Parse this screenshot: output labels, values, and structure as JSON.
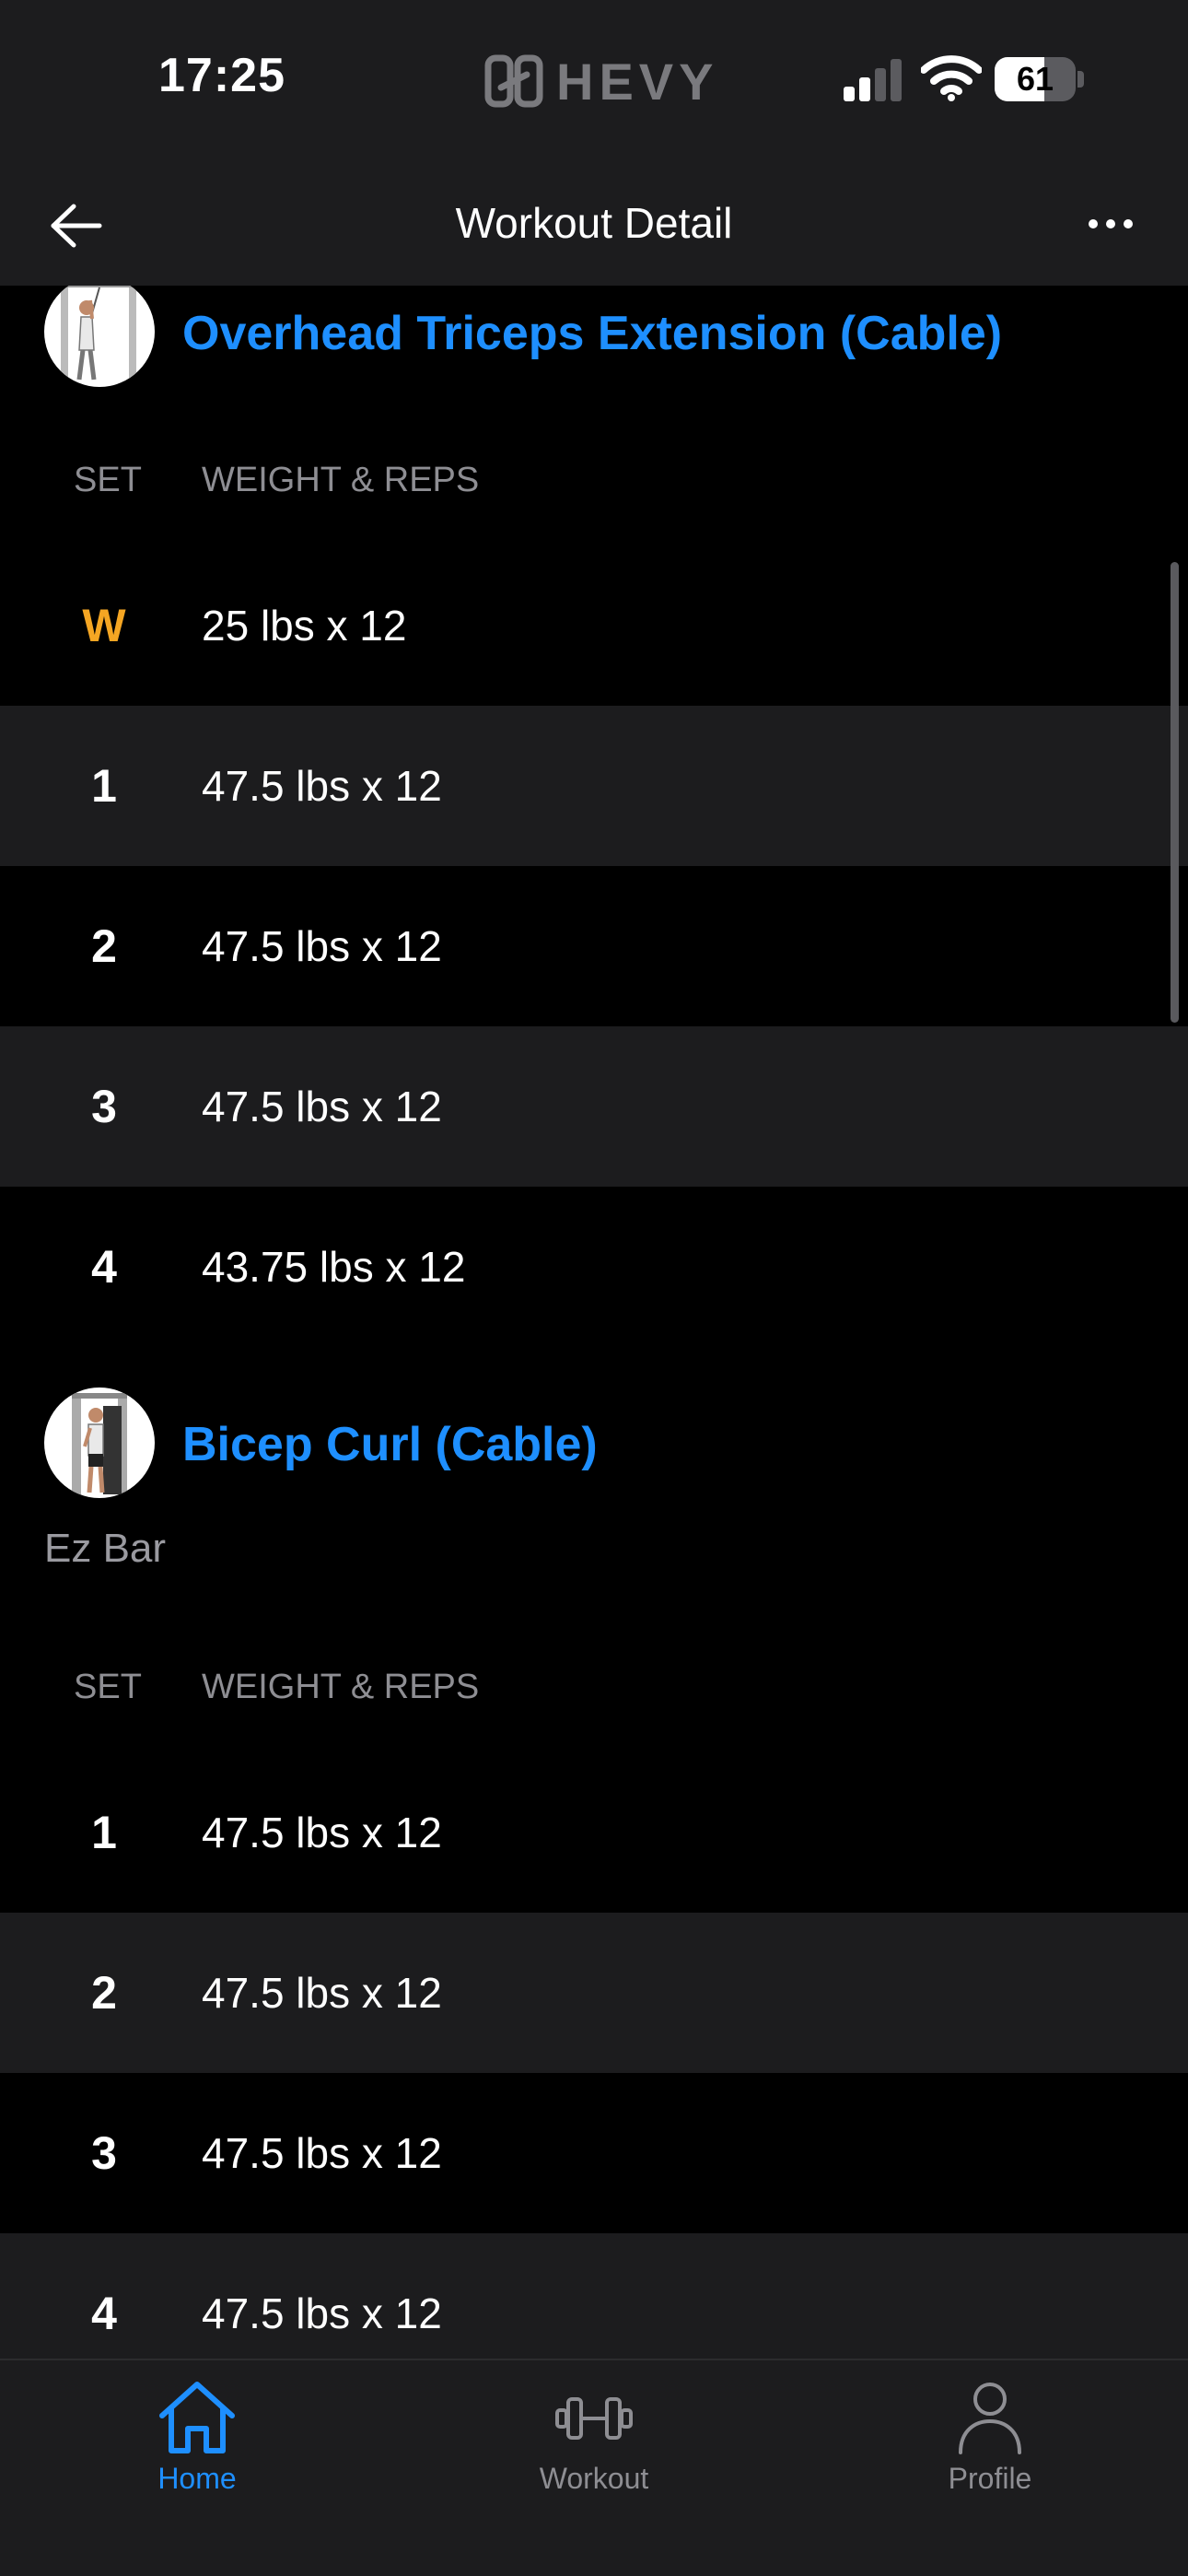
{
  "status_bar": {
    "time": "17:25",
    "brand": "HEVY",
    "battery_percent": 61
  },
  "nav": {
    "title": "Workout Detail",
    "back_icon": "arrow-left-icon",
    "more_icon": "ellipsis-icon"
  },
  "exercises": [
    {
      "title": "Overhead Triceps Extension (Cable)",
      "note": "",
      "columns": {
        "set": "SET",
        "weight_reps": "WEIGHT & REPS"
      },
      "sets": [
        {
          "set": "W",
          "value": "25 lbs x 12",
          "warmup": true
        },
        {
          "set": "1",
          "value": "47.5 lbs x 12"
        },
        {
          "set": "2",
          "value": "47.5 lbs x 12"
        },
        {
          "set": "3",
          "value": "47.5 lbs x 12"
        },
        {
          "set": "4",
          "value": "43.75 lbs x 12"
        }
      ]
    },
    {
      "title": "Bicep Curl (Cable)",
      "note": "Ez Bar",
      "columns": {
        "set": "SET",
        "weight_reps": "WEIGHT & REPS"
      },
      "sets": [
        {
          "set": "1",
          "value": "47.5 lbs x 12"
        },
        {
          "set": "2",
          "value": "47.5 lbs x 12"
        },
        {
          "set": "3",
          "value": "47.5 lbs x 12"
        },
        {
          "set": "4",
          "value": "47.5 lbs x 12"
        }
      ]
    }
  ],
  "tab_bar": {
    "items": [
      {
        "label": "Home",
        "icon": "home-icon",
        "active": true
      },
      {
        "label": "Workout",
        "icon": "dumbbell-icon",
        "active": false
      },
      {
        "label": "Profile",
        "icon": "person-icon",
        "active": false
      }
    ]
  },
  "colors": {
    "accent": "#1e8fff",
    "warmup": "#f5a623",
    "background": "#000000",
    "surface": "#1c1c1e"
  }
}
